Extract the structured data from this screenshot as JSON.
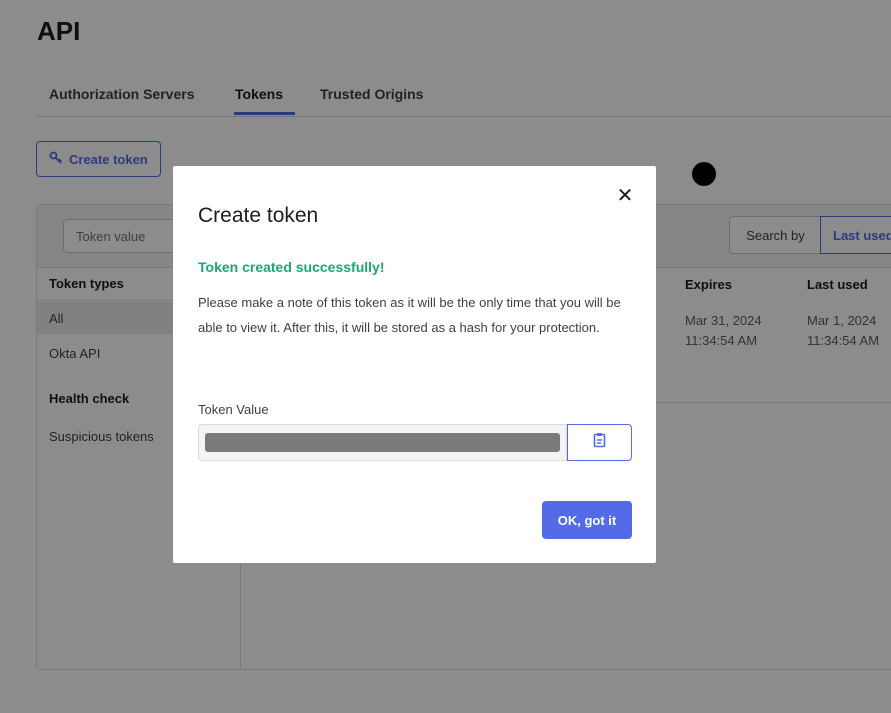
{
  "page": {
    "title": "API"
  },
  "tabs": [
    {
      "label": "Authorization Servers"
    },
    {
      "label": "Tokens"
    },
    {
      "label": "Trusted Origins"
    }
  ],
  "toolbar": {
    "create_token_label": "Create token",
    "create_token_icon": "key-plus-icon"
  },
  "filters": {
    "search_placeholder": "Token value",
    "search_by_label": "Search by",
    "last_used_label": "Last used"
  },
  "sidebar": {
    "heading": "Token types",
    "items": [
      {
        "label": "All"
      },
      {
        "label": "Okta API"
      }
    ],
    "health_heading": "Health check",
    "health_items": [
      {
        "label": "Suspicious tokens"
      }
    ]
  },
  "table": {
    "columns": [
      {
        "label": "Expires"
      },
      {
        "label": "Last used"
      }
    ],
    "rows": [
      {
        "expires_date": "Mar 31, 2024",
        "expires_time": "11:34:54 AM",
        "last_used_date": "Mar 1, 2024",
        "last_used_time": "11:34:54 AM"
      }
    ]
  },
  "modal": {
    "title": "Create token",
    "close_icon": "close-icon",
    "success_text": "Token created successfully!",
    "note_text": "Please make a note of this token as it will be the only time that you will be able to view it. After this, it will be stored as a hash for your protection.",
    "token_value_label": "Token Value",
    "copy_icon": "clipboard-icon",
    "ok_label": "OK, got it"
  },
  "colors": {
    "accent": "#546be7",
    "success": "#1ea672",
    "overlay": "rgba(0,0,0,0.45)"
  }
}
